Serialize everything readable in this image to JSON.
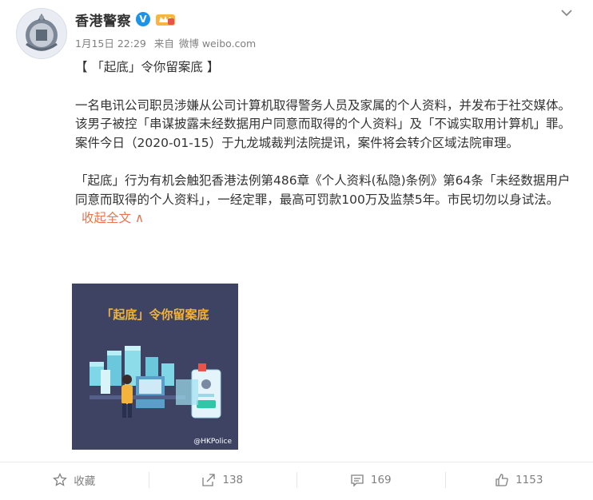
{
  "post": {
    "author": "香港警察",
    "date": "1月15日 22:29",
    "source_prefix": "来自",
    "source": "微博 weibo.com",
    "title": "【 「起底」令你留案底 】",
    "paragraph1": "一名电讯公司职员涉嫌从公司计算机取得警务人员及家属的个人资料，并发布于社交媒体。该男子被控「串谋披露未经数据用户同意而取得的个人资料」及「不诚实取用计算机」罪。案件今日（2020-01-15）于九龙城裁判法院提讯，案件将会转介区域法院审理。",
    "paragraph2": "「起底」行为有机会触犯香港法例第486章《个人资料(私隐)条例》第64条「未经数据用户同意而取得的个人资料」，一经定罪，最高可罚款100万及监禁5年。市民切勿以身试法。",
    "collapse_label": "收起全文 ∧"
  },
  "image": {
    "headline": "「起底」令你留案底",
    "watermark": "@HKPolice",
    "background_color": "#3e4363",
    "headline_color": "#f2b43c"
  },
  "footer": {
    "favorite_label": "收藏",
    "repost_count": "138",
    "comment_count": "169",
    "like_count": "1153"
  },
  "colors": {
    "link": "#eb7350",
    "verified": "#1b93e8",
    "muted": "#808080"
  }
}
